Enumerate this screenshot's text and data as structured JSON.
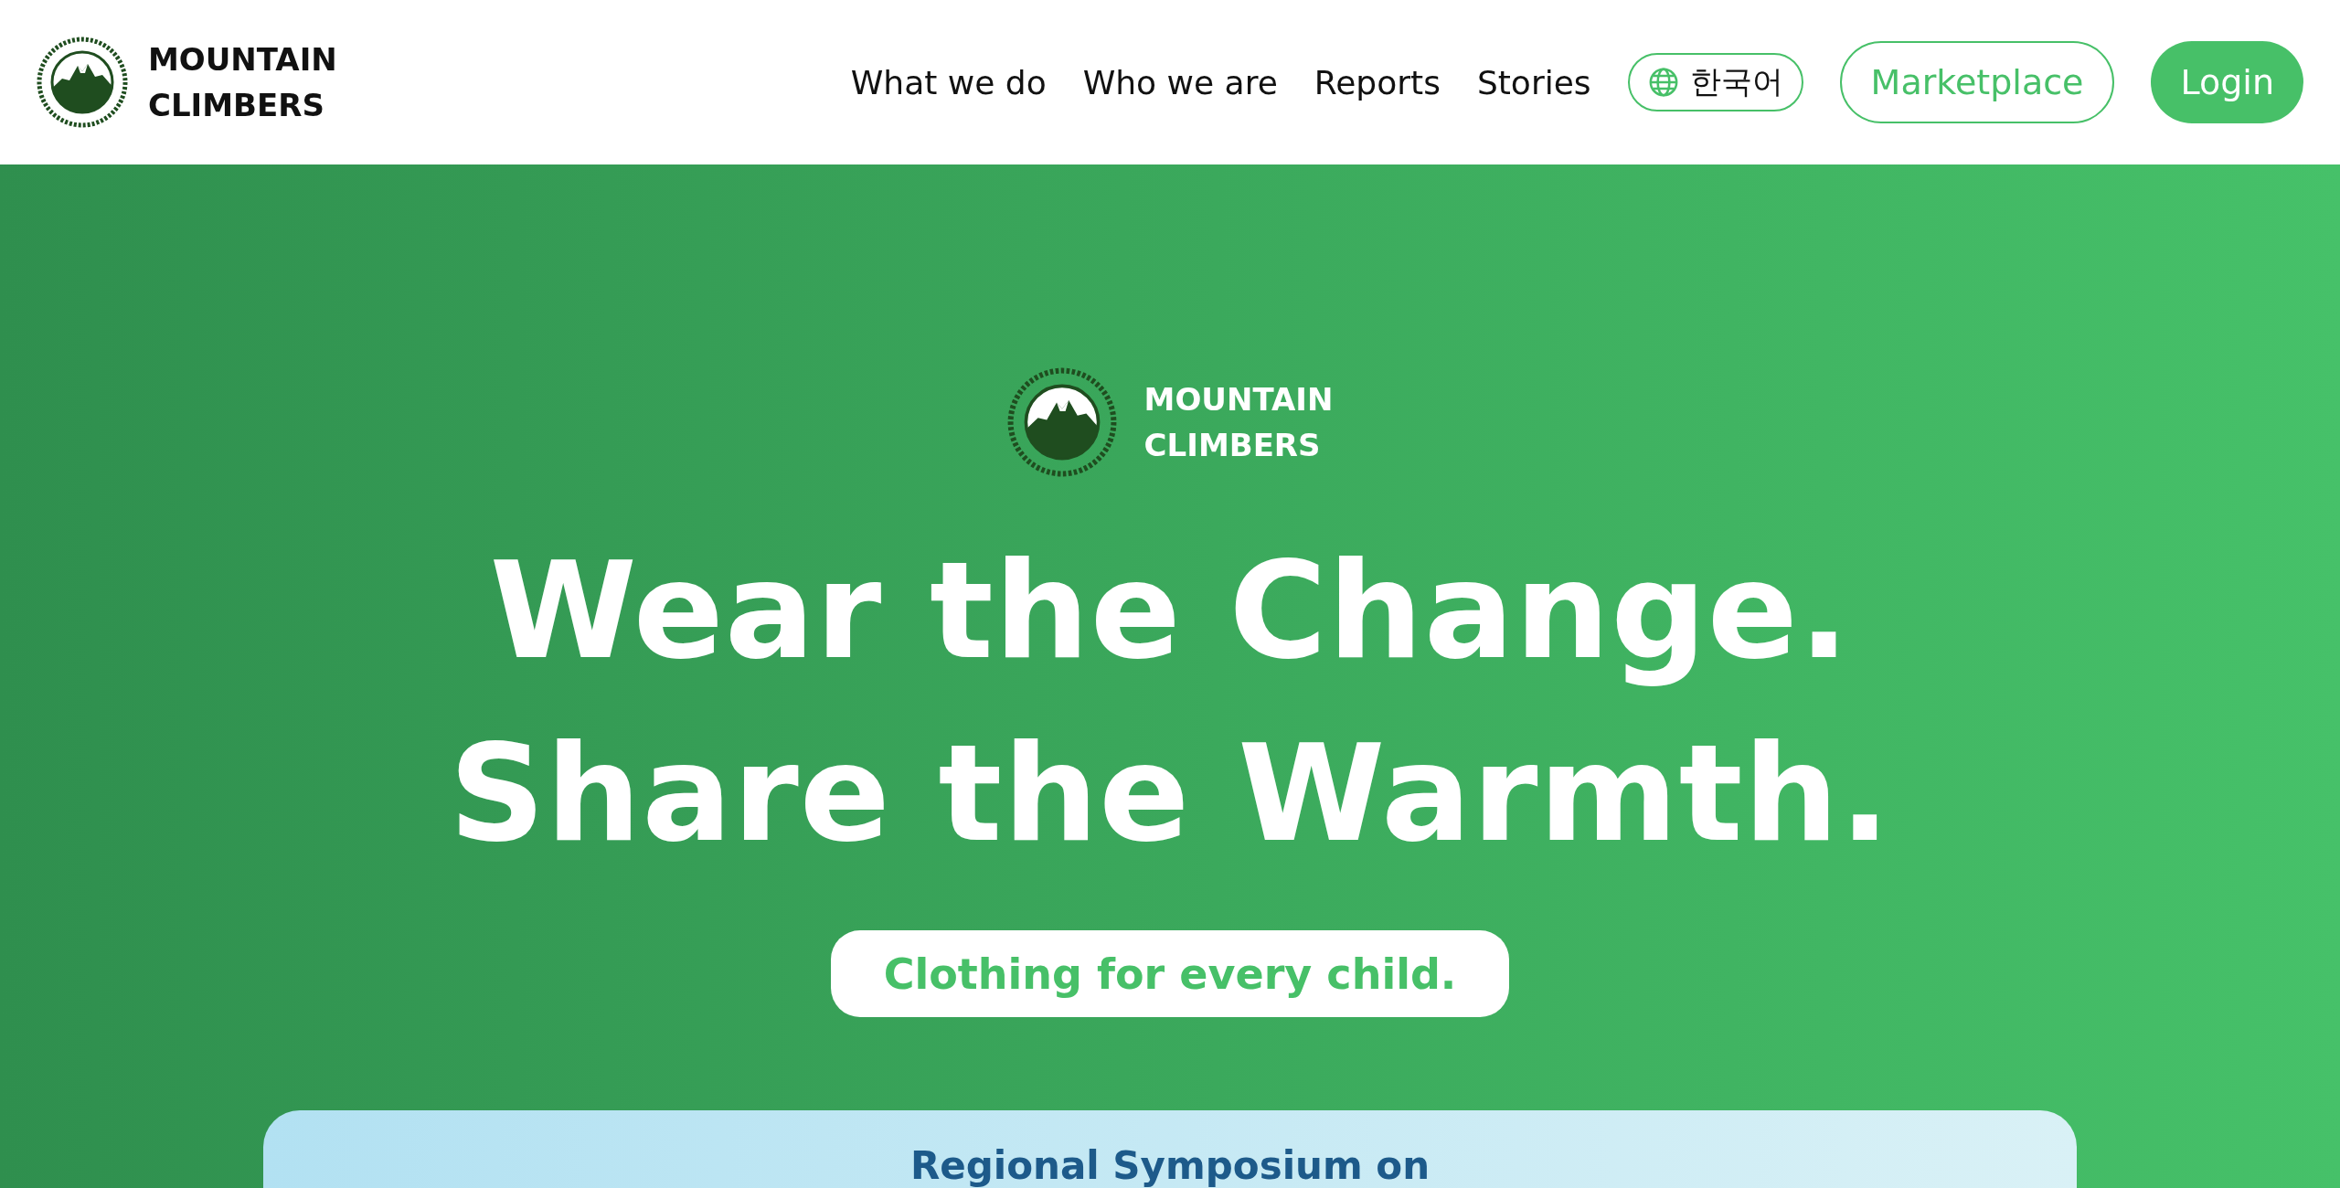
{
  "header": {
    "brand": "MOUNTAIN CLIMBERS",
    "nav": [
      {
        "label": "What we do"
      },
      {
        "label": "Who we are"
      },
      {
        "label": "Reports"
      },
      {
        "label": "Stories"
      }
    ],
    "language": {
      "label": "한국어"
    },
    "buttons": [
      {
        "label": "Marketplace",
        "kind": "outline"
      },
      {
        "label": "Login",
        "kind": "filled"
      }
    ]
  },
  "hero": {
    "brand": "MOUNTAIN CLIMBERS",
    "headline": [
      "Wear the Change.",
      "Share the Warmth."
    ],
    "tagline": "Clothing for every child.",
    "banner": {
      "title": "Regional Symposium on"
    }
  }
}
